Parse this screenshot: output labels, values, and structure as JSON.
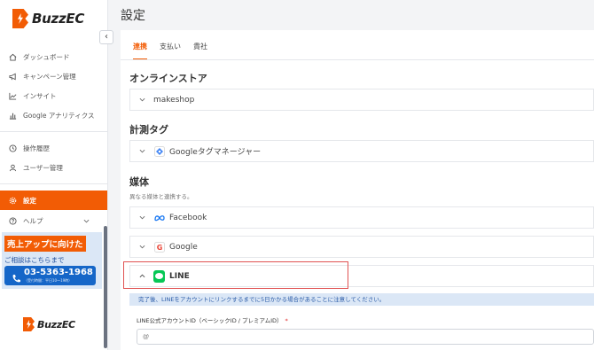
{
  "brand": {
    "name": "BuzzEC",
    "accent": "#f25c05"
  },
  "sidebar": {
    "collapse_icon": "‹",
    "items": [
      {
        "label": "ダッシュボード",
        "icon": "home-icon"
      },
      {
        "label": "キャンペーン管理",
        "icon": "megaphone-icon"
      },
      {
        "label": "インサイト",
        "icon": "trend-icon"
      },
      {
        "label": "Google アナリティクス",
        "icon": "bar-chart-icon"
      },
      {
        "label": "操作履歴",
        "icon": "clock-icon"
      },
      {
        "label": "ユーザー管理",
        "icon": "user-icon"
      },
      {
        "label": "設定",
        "icon": "gear-icon",
        "active": true
      },
      {
        "label": "ヘルプ",
        "icon": "help-icon"
      }
    ],
    "promo": {
      "title": "売上アップに向けた",
      "sub": "ご相談はこちらまで",
      "phone": "03-5363-1968",
      "hours": "（受付時間：平日10〜19時）"
    }
  },
  "main": {
    "title": "設定",
    "tabs": [
      "連携",
      "支払い",
      "貴社"
    ],
    "sections": {
      "store": {
        "title": "オンラインストア",
        "item": "makeshop"
      },
      "tracking": {
        "title": "計測タグ",
        "item": "Googleタグマネージャー"
      },
      "media": {
        "title": "媒体",
        "desc": "異なる媒体と連携する。",
        "items": [
          "Facebook",
          "Google",
          "LINE"
        ]
      }
    },
    "line": {
      "notice": "完了後、LINEをアカウントにリンクするまでに5日かかる場合があることに注意してください。",
      "field_label": "LINE公式アカウントID（ベーシックID / プレミアムID）",
      "required_mark": "*",
      "field_placeholder": "@"
    }
  }
}
